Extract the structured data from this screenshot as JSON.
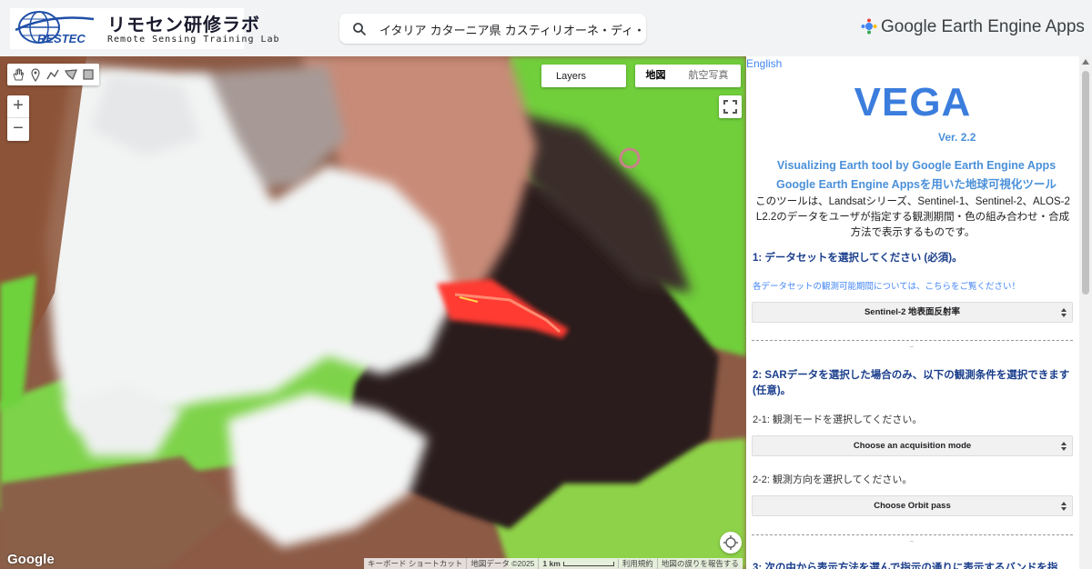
{
  "header": {
    "logo_jp": "リモセン研修ラボ",
    "logo_en": "Remote Sensing Training Lab",
    "logo_mark": "RESTEC",
    "search_value": "イタリア カターニア県 カスティリオーネ・ディ・シチ",
    "brand": "Google Earth Engine Apps"
  },
  "map": {
    "layers_label": "Layers",
    "maptype_map": "地図",
    "maptype_satellite": "航空写真",
    "zoom_in": "+",
    "zoom_out": "−",
    "google_logo": "Google",
    "attribution": {
      "shortcuts": "キーボード ショートカット",
      "map_data": "地図データ ©2025",
      "scale": "1 km",
      "terms": "利用規約",
      "report": "地図の誤りを報告する"
    }
  },
  "panel": {
    "lang_link": "English",
    "title": "VEGA",
    "version": "Ver. 2.2",
    "subtitle_en": "Visualizing Earth tool by Google Earth Engine Apps",
    "subtitle_jp": "Google Earth Engine Appsを用いた地球可視化ツール",
    "description": "このツールは、Landsatシリーズ、Sentinel-1、Sentinel-2、ALOS-2 L2.2のデータをユーザが指定する観測期間・色の組み合わせ・合成方法で表示するものです。",
    "step1_heading": "1: データセットを選択してください (必須)。",
    "step1_note": "各データセットの観測可能期間については、こちらをご覧ください！",
    "step1_select": "Sentinel-2 地表面反射率",
    "step2_heading": "2: SARデータを選択した場合のみ、以下の観測条件を選択できます (任意)。",
    "step2_1_label": "2-1: 観測モードを選択してください。",
    "step2_1_select": "Choose an acquisition mode",
    "step2_2_label": "2-2: 観測方向を選択してください。",
    "step2_2_select": "Choose Orbit pass",
    "step3_heading": "3: 次の中から表示方法を選んで指示の通りに表示するバンドを指"
  },
  "colors": {
    "title_blue": "#3b7ddd",
    "link_blue": "#4285f4",
    "heading_navy": "#1a3e8c",
    "lava_red": "#ff3b30"
  }
}
